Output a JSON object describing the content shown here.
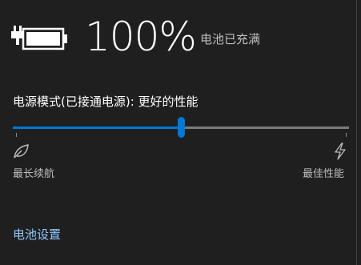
{
  "battery": {
    "percent_text": "100%",
    "status_text": "电池已充满",
    "icon": "battery-plugged-icon"
  },
  "power_mode": {
    "label": "电源模式(已接通电源): 更好的性能",
    "slider_value_fraction": 0.5,
    "left_end_label": "最长续航",
    "right_end_label": "最佳性能",
    "left_end_icon": "leaf-icon",
    "right_end_icon": "lightning-icon"
  },
  "links": {
    "battery_settings": "电池设置"
  },
  "colors": {
    "accent": "#0078d7",
    "link": "#8fc8ff",
    "background": "#1f1f1f"
  }
}
